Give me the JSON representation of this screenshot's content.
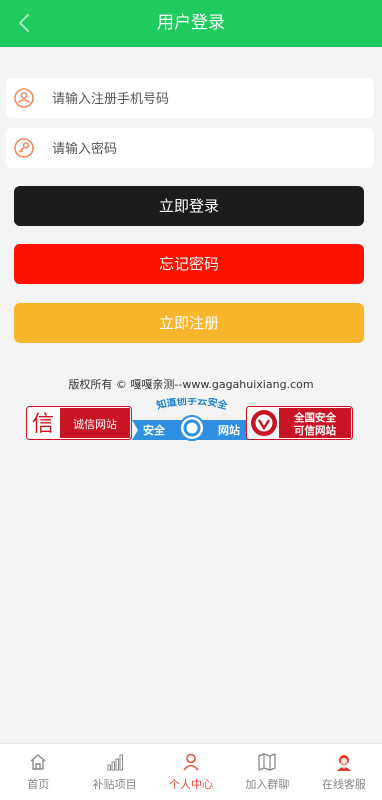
{
  "header": {
    "title": "用户登录"
  },
  "form": {
    "phone_placeholder": "请输入注册手机号码",
    "password_placeholder": "请输入密码"
  },
  "buttons": {
    "login": "立即登录",
    "forgot": "忘记密码",
    "register": "立即注册"
  },
  "colors": {
    "header": "#1ecb5c",
    "login": "#1c1c1c",
    "forgot": "#ff1100",
    "register": "#f8b62d",
    "active_tab": "#ee4e3e"
  },
  "footer": {
    "copyright": "版权所有 © 嘎嘎亲测--www.gagahuixiang.com",
    "badges": {
      "credit": {
        "mark": "信",
        "text": "诚信网站"
      },
      "security": {
        "arc": "知道创宇云安全",
        "left": "安全",
        "right": "网站"
      },
      "trust": {
        "line1": "全国安全",
        "line2": "可信网站"
      }
    }
  },
  "tabbar": [
    {
      "label": "首页",
      "icon": "home-icon"
    },
    {
      "label": "补贴项目",
      "icon": "bar-chart-icon"
    },
    {
      "label": "个人中心",
      "icon": "user-icon",
      "active": true
    },
    {
      "label": "加入群聊",
      "icon": "map-icon"
    },
    {
      "label": "在线客服",
      "icon": "customer-service-icon"
    }
  ]
}
